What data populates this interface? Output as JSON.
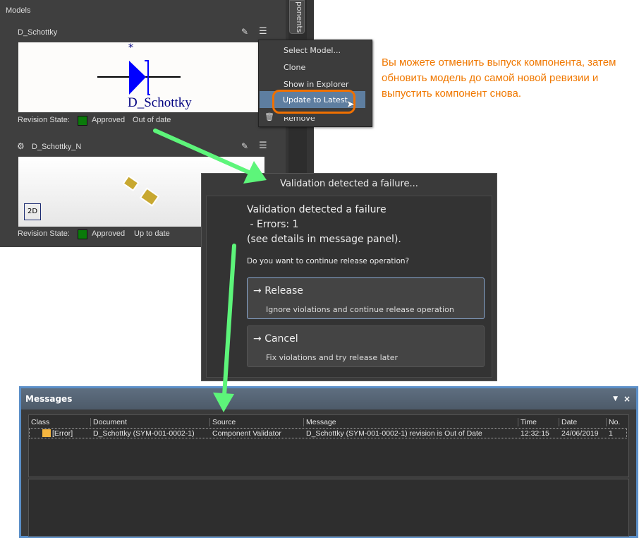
{
  "models": {
    "title": "Models",
    "side_tab": "ponents",
    "items": [
      {
        "name": "D_Schottky",
        "symbol_label": "D_Schottky",
        "designator": "*",
        "revision_label": "Revision State:",
        "state": "Approved",
        "status": "Out of date"
      },
      {
        "name": "D_Schottky_N",
        "view_button": "2D",
        "revision_label": "Revision State:",
        "state": "Approved",
        "status": "Up to date"
      }
    ]
  },
  "context_menu": {
    "items": [
      "Select Model...",
      "Clone",
      "Show in Explorer",
      "Update to Latest",
      "Remove"
    ]
  },
  "note": "Вы можете отменить выпуск компонента, затем обновить модель до самой новой ревизии и выпустить компонент снова.",
  "dialog": {
    "title": "Validation detected a failure...",
    "line1": "Validation detected a failure",
    "line2": " - Errors: 1",
    "line3": "(see details in message panel).",
    "question": "Do you want to continue release operation?",
    "release": {
      "label": "Release",
      "desc": "Ignore violations and continue release operation"
    },
    "cancel": {
      "label": "Cancel",
      "desc": "Fix violations and try release later"
    }
  },
  "messages": {
    "title": "Messages",
    "columns": [
      "Class",
      "Document",
      "Source",
      "Message",
      "Time",
      "Date",
      "No."
    ],
    "rows": [
      {
        "class": "[Error]",
        "document": "D_Schottky (SYM-001-0002-1)",
        "source": "Component Validator",
        "message": "D_Schottky (SYM-001-0002-1) revision is Out of Date",
        "time": "12:32:15",
        "date": "24/06/2019",
        "no": "1"
      }
    ]
  },
  "colors": {
    "accent": "#f07000",
    "arrow": "#5df57a",
    "approved": "#0a7a0a"
  }
}
